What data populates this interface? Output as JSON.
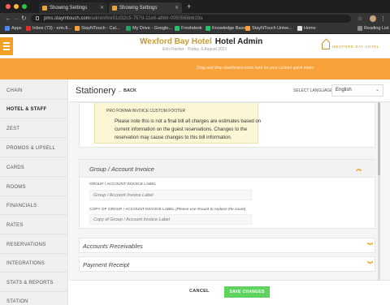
{
  "browser": {
    "tabs": [
      {
        "title": "Showing Settings"
      },
      {
        "title": "Showing Settings"
      }
    ],
    "url_host": "pms.staymtouch.com",
    "url_path": "/admin/h/e51d32c5-757d-11e6-a868-0050568b619a",
    "bookmarks": [
      "Apps",
      "Inbox (73) - erin.fi...",
      "StayNTouch - Cal...",
      "My Drive - Google...",
      "Freshdesk",
      "Knowledge Base",
      "StayNTouch Unive...",
      "Home",
      "Reading List"
    ],
    "colors": {
      "close": "#ff5f57",
      "minimize": "#febc2e",
      "maximize": "#28c840"
    }
  },
  "header": {
    "hotel_name": "Wexford Bay Hotel",
    "admin_label": "Hotel Admin",
    "subtitle": "Erin Fischer  ·  Friday, 6 August 2021",
    "logo_text": "WEXFORD BAY HOTEL",
    "strip_hint": "Drag and drop dashboard icons here for your custom quick menu",
    "accent": "#f9a13a"
  },
  "sidebar": {
    "items": [
      {
        "label": "CHAIN"
      },
      {
        "label": "HOTEL & STAFF"
      },
      {
        "label": "ZEST"
      },
      {
        "label": "PROMOS & UPSELL"
      },
      {
        "label": "CARDS"
      },
      {
        "label": "ROOMS"
      },
      {
        "label": "FINANCIALS"
      },
      {
        "label": "RATES"
      },
      {
        "label": "RESERVATIONS"
      },
      {
        "label": "INTEGRATIONS"
      },
      {
        "label": "STATS & REPORTS"
      },
      {
        "label": "STATION"
      }
    ]
  },
  "main": {
    "title": "Stationery",
    "back_label": "BACK",
    "language_label": "SELECT LANGUAGE",
    "language_value": "English",
    "proforma": {
      "label": "PRO FORMA INVOICE CUSTOM FOOTER",
      "text": "Please note this is not a final bill all charges are estimates based on current information on the guest reservations. Changes to the reservation may cause changes to this bill information."
    },
    "group_invoice": {
      "title": "Group / Account Invoice",
      "label_field": {
        "label": "GROUP / ACCOUNT INVOICE LABEL",
        "placeholder": "Group / Account Invoice Label"
      },
      "copy_field": {
        "label": "COPY OF GROUP / ACCOUNT INVOICE LABEL",
        "note": "(Please use #count to replace the count)",
        "placeholder": "Copy of Group / Account Invoice Label"
      }
    },
    "accordions": [
      {
        "title": "Accounts Receivables"
      },
      {
        "title": "Payment Receipt"
      }
    ],
    "actions": {
      "cancel": "CANCEL",
      "save": "SAVE CHANGES"
    }
  }
}
